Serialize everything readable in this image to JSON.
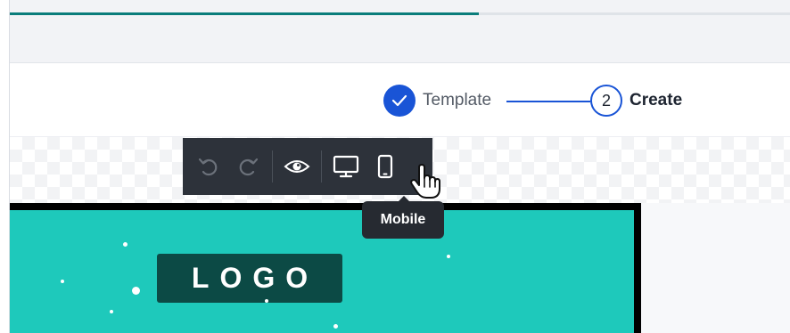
{
  "progress": {
    "value": 0.6
  },
  "stepper": {
    "step1": {
      "label": "Template",
      "state": "completed"
    },
    "step2": {
      "number": "2",
      "label": "Create",
      "state": "active"
    }
  },
  "toolbar": {
    "buttons": [
      {
        "icon": "undo-icon",
        "enabled": false
      },
      {
        "icon": "redo-icon",
        "enabled": false
      },
      {
        "icon": "eye-icon",
        "enabled": true
      },
      {
        "icon": "desktop-icon",
        "enabled": true
      },
      {
        "icon": "mobile-icon",
        "enabled": true
      }
    ],
    "tooltip": "Mobile"
  },
  "email": {
    "logo_text": "LOGO"
  },
  "colors": {
    "accent": "#1954d6",
    "progress": "#0b7d7b",
    "toolbar_bg": "#2d323a",
    "email_bg": "#1ec9bb",
    "logo_bg": "#0c4a45"
  }
}
